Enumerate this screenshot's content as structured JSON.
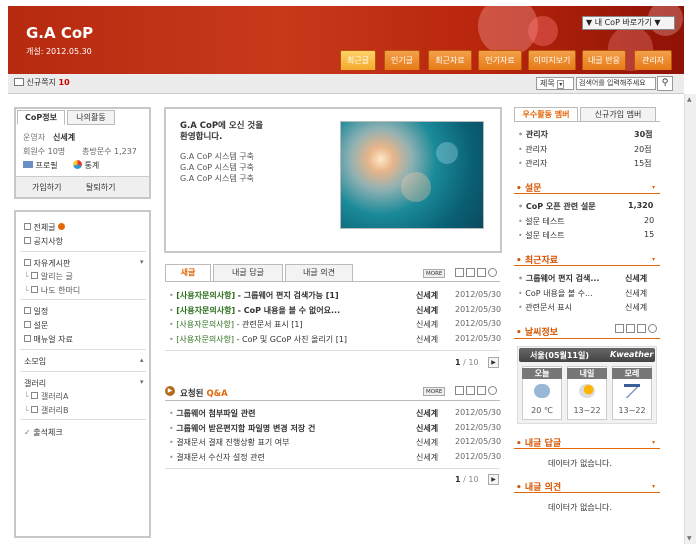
{
  "header": {
    "title": "G.A CoP",
    "date": "개설: 2012.05.30",
    "shortcut": "▼ 내 CoP 바로가기 ▼",
    "nav": [
      "최근글",
      "인기글",
      "최근자료",
      "인기자료",
      "이미지보기",
      "내글 반응",
      "관리자"
    ]
  },
  "notice": {
    "label": "신규쪽지",
    "count": "10"
  },
  "search": {
    "select": "제목",
    "placeholder": "검색어를 입력해주세요"
  },
  "profile": {
    "tabs": [
      "CoP정보",
      "나의활동"
    ],
    "operator_label": "운영자",
    "operator": "신세계",
    "members": "회원수 10명",
    "posts": "총방문수 1,237",
    "profile_link": "프로필",
    "stats_link": "통계",
    "join": "가입하기",
    "leave": "탈퇴하기"
  },
  "menu": {
    "items": [
      "전체글",
      "공지사항",
      "자유게시판",
      "알리는 글",
      "나도 한마디",
      "일정",
      "설문",
      "매뉴얼 자료",
      "소모임",
      "갤러리",
      "갤러리A",
      "갤러리B",
      "출석체크"
    ]
  },
  "welcome": {
    "title": "G.A CoP에 오신 것을",
    "title2": "환영합니다.",
    "lines": [
      "G.A CoP 시스템 구축",
      "G.A CoP 시스템 구축",
      "G.A CoP 시스템 구축"
    ]
  },
  "posts": {
    "tabs": [
      "새글",
      "내글 답글",
      "내글 의견"
    ],
    "more": "MORE",
    "rows": [
      {
        "cat": "[사용자문의사항]",
        "title": "- 그룹웨어 편지 검색가능 [1]",
        "author": "신세계",
        "date": "2012/05/30",
        "strong": true
      },
      {
        "cat": "[사용자문의사항]",
        "title": "- CoP 내용을 볼 수 없어요...",
        "author": "신세계",
        "date": "2012/05/30",
        "strong": true
      },
      {
        "cat": "[사용자문의사항]",
        "title": "- 관련문서 표시 [1]",
        "author": "신세계",
        "date": "2012/05/30",
        "strong": false
      },
      {
        "cat": "[사용자문의사항]",
        "title": "- CoP 및 GCoP 사진 올리기 [1]",
        "author": "신세계",
        "date": "2012/05/30",
        "strong": false
      }
    ],
    "page": "1",
    "total": "/ 10"
  },
  "qa": {
    "title_a": "요청된",
    "title_b": "Q&A",
    "more": "MORE",
    "rows": [
      {
        "title": "그룹웨어 첨부파일 관련",
        "author": "신세계",
        "date": "2012/05/30",
        "strong": true
      },
      {
        "title": "그룹웨어 받은편지함 파일명 변경 저장 건",
        "author": "신세계",
        "date": "2012/05/30",
        "strong": true
      },
      {
        "title": "결재문서 결재 진행상황 표기 여부",
        "author": "신세계",
        "date": "2012/05/30",
        "strong": false
      },
      {
        "title": "결재문서 수신자 설정 관련",
        "author": "신세계",
        "date": "2012/05/30",
        "strong": false
      }
    ],
    "page": "1",
    "total": "/ 10"
  },
  "ranking": {
    "tabs": [
      "우수활동 멤버",
      "신규가입 멤버"
    ],
    "rows": [
      {
        "name": "관리자",
        "score": "30점"
      },
      {
        "name": "관리자",
        "score": "20점"
      },
      {
        "name": "관리자",
        "score": "15점"
      }
    ]
  },
  "survey": {
    "title": "설문",
    "rows": [
      {
        "name": "CoP 오픈 관련 설문",
        "val": "1,320"
      },
      {
        "name": "설문 테스트",
        "val": "20"
      },
      {
        "name": "설문 테스트",
        "val": "15"
      }
    ]
  },
  "recent": {
    "title": "최근자료",
    "rows": [
      {
        "name": "그룹웨어 편지 검색...",
        "author": "신세계"
      },
      {
        "name": "CoP 내용을 볼 수...",
        "author": "신세계"
      },
      {
        "name": "관련문서 표시",
        "author": "신세계"
      }
    ]
  },
  "weather": {
    "title": "날씨정보",
    "city": "서울(05월11일)",
    "brand": "Kweather",
    "days": [
      {
        "label": "오늘",
        "temp": "20 ℃"
      },
      {
        "label": "내일",
        "temp": "13~22"
      },
      {
        "label": "모레",
        "temp": "13~22"
      }
    ]
  },
  "reply": {
    "title": "내글 답글",
    "empty": "데이터가 없습니다."
  },
  "opinion": {
    "title": "내글 의견",
    "empty": "데이터가 없습니다."
  },
  "colors": {
    "accent": "#e2660a",
    "brand": "#c8391a",
    "green": "#2d6f1d"
  }
}
